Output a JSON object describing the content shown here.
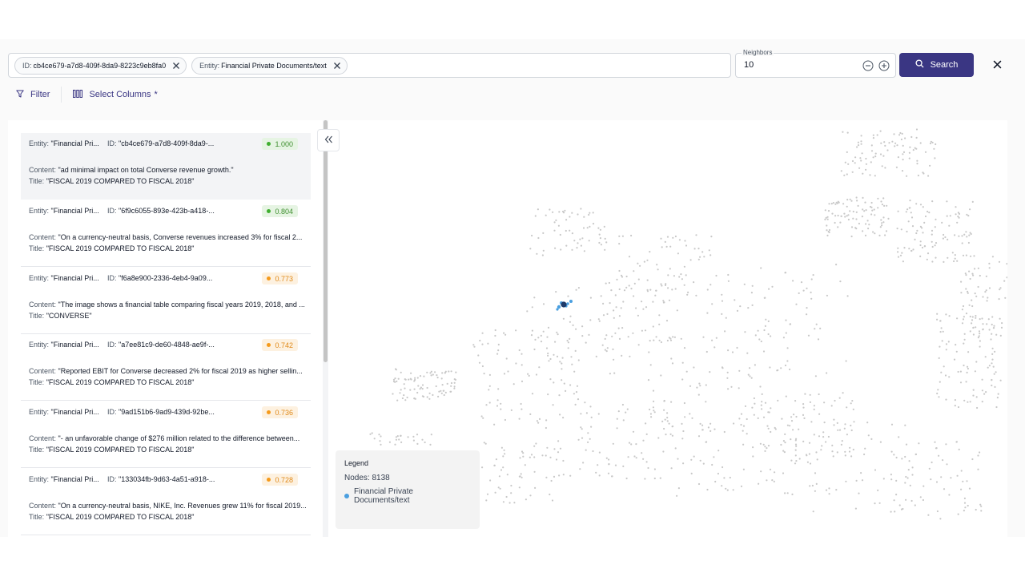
{
  "search": {
    "chips": [
      {
        "prefix": "ID:",
        "value": "cb4ce679-a7d8-409f-8da9-8223c9eb8fa0"
      },
      {
        "prefix": "Entity:",
        "value": "Financial Private Documents/text"
      }
    ],
    "neighbors_label": "Neighbors",
    "neighbors_value": "10",
    "search_label": "Search"
  },
  "toolbar": {
    "filter_label": "Filter",
    "columns_label": "Select Columns",
    "columns_marker": "*"
  },
  "labels": {
    "entity": "Entity:",
    "id": "ID:",
    "content": "Content:",
    "title": "Title:"
  },
  "results": [
    {
      "entity": "\"Financial Pri...",
      "id": "\"cb4ce679-a7d8-409f-8da9-...",
      "score": "1.000",
      "content": "\"ad minimal impact on total Converse revenue growth.\"",
      "title": "\"FISCAL 2019 COMPARED TO FISCAL 2018\""
    },
    {
      "entity": "\"Financial Pri...",
      "id": "\"6f9c6055-893e-423b-a418-...",
      "score": "0.804",
      "content": "\"On a currency-neutral basis, Converse revenues increased 3% for fiscal 2...",
      "title": "\"FISCAL 2019 COMPARED TO FISCAL 2018\""
    },
    {
      "entity": "\"Financial Pri...",
      "id": "\"f6a8e900-2336-4eb4-9a09...",
      "score": "0.773",
      "content": "\"The image shows a financial table comparing fiscal years 2019, 2018, and ...",
      "title": "\"CONVERSE\""
    },
    {
      "entity": "\"Financial Pri...",
      "id": "\"a7ee81c9-de60-4848-ae9f-...",
      "score": "0.742",
      "content": "\"Reported EBIT for Converse decreased 2% for fiscal 2019 as higher sellin...",
      "title": "\"FISCAL 2019 COMPARED TO FISCAL 2018\""
    },
    {
      "entity": "\"Financial Pri...",
      "id": "\"9ad151b6-9ad9-439d-92be...",
      "score": "0.736",
      "content": "\"- an unfavorable change of $276 million related to the difference between...",
      "title": "\"FISCAL 2019 COMPARED TO FISCAL 2018\""
    },
    {
      "entity": "\"Financial Pri...",
      "id": "\"133034fb-9d63-4a51-a918-...",
      "score": "0.728",
      "content": "\"On a currency-neutral basis, NIKE, Inc. Revenues grew 11% for fiscal 2019...",
      "title": "\"FISCAL 2019 COMPARED TO FISCAL 2018\""
    }
  ],
  "legend": {
    "title": "Legend",
    "nodes": "Nodes: 8138",
    "item": "Financial Private Documents/text"
  },
  "colors": {
    "accent": "#3a3683",
    "node_gray": "#c8c8c8",
    "node_blue": "#4a9fe0",
    "node_dark": "#1e3a6a",
    "score_green_bg": "#e6f4e3",
    "score_green_text": "#3f8f2f",
    "score_green_dot": "#3fae2f",
    "score_orange_bg": "#fdf1e0",
    "score_orange_text": "#e08a1a",
    "score_orange_dot": "#f59a1b"
  },
  "icons": {
    "chip_close": "x-icon",
    "minus": "minus-circle-icon",
    "plus": "plus-circle-icon",
    "search": "search-icon",
    "close": "close-icon",
    "filter": "filter-icon",
    "columns": "columns-icon",
    "collapse": "chevrons-left-icon"
  }
}
